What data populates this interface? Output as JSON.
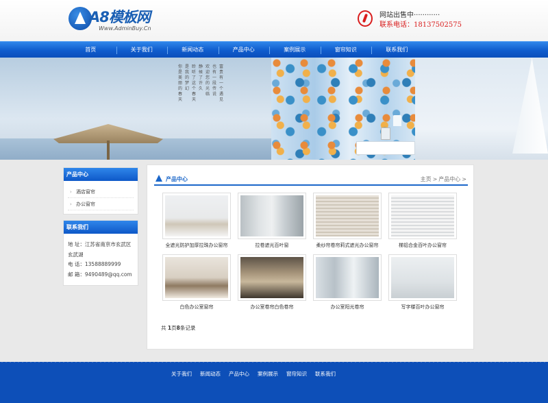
{
  "brand": {
    "logo_title": "A8模板网",
    "logo_sub": "Www.AdminBuy.Cn"
  },
  "hotline": {
    "line1": "网站出售中············",
    "line2": "联系电话：18137502575"
  },
  "nav": {
    "items": [
      "首页",
      "关于我们",
      "新闻动态",
      "产品中心",
      "案例展示",
      "窗帘知识",
      "联系我们"
    ]
  },
  "banner": {
    "poem": [
      "富贵有一个遇见",
      "也有一段传说",
      "欢迎您的光临",
      "静候了许久",
      "聆听了这个春天",
      "是我的梦幻",
      "你是美丽的春天"
    ]
  },
  "sidebar": {
    "category_title": "产品中心",
    "categories": [
      "酒店窗帘",
      "办公窗帘"
    ],
    "contact_title": "联系我们",
    "contact": {
      "address": "地 址：江苏省南京市玄武区玄武湖",
      "phone": "电 话：13588889999",
      "email": "邮 箱：9490489@qq.com"
    }
  },
  "main": {
    "section_title": "产品中心",
    "breadcrumb": {
      "home": "主页",
      "sep": ">",
      "current": "产品中心",
      "tail": ">"
    },
    "products": [
      {
        "name": "全遮光防护加厚拉珠办公窗帘"
      },
      {
        "name": "拉卷遮光百叶窗"
      },
      {
        "name": "柔纱帘卷帘莉式遮光办公窗帘"
      },
      {
        "name": "梯铝合金百叶办公窗帘"
      },
      {
        "name": "白色办公室窗帘"
      },
      {
        "name": "办公室卷帘白色卷帘"
      },
      {
        "name": "办公室阳光卷帘"
      },
      {
        "name": "写字楼百叶办公窗帘"
      }
    ],
    "pager": {
      "prefix": "共",
      "pages": "1",
      "mid": "页",
      "records": "8",
      "suffix": "条记录"
    }
  },
  "footer": {
    "links": [
      "关于我们",
      "新闻动态",
      "产品中心",
      "案例展示",
      "窗帘知识",
      "联系我们"
    ]
  }
}
